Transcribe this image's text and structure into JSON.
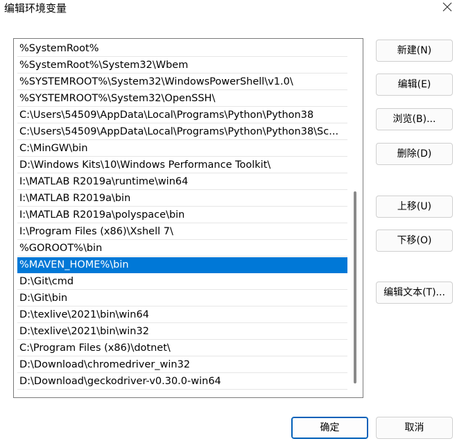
{
  "window": {
    "title": "编辑环境变量"
  },
  "path_list": {
    "items": [
      "%SystemRoot%",
      "%SystemRoot%\\System32\\Wbem",
      "%SYSTEMROOT%\\System32\\WindowsPowerShell\\v1.0\\",
      "%SYSTEMROOT%\\System32\\OpenSSH\\",
      "C:\\Users\\54509\\AppData\\Local\\Programs\\Python\\Python38",
      "C:\\Users\\54509\\AppData\\Local\\Programs\\Python\\Python38\\Sc...",
      "C:\\MinGW\\bin",
      "D:\\Windows Kits\\10\\Windows Performance Toolkit\\",
      "I:\\MATLAB R2019a\\runtime\\win64",
      "I:\\MATLAB R2019a\\bin",
      "I:\\MATLAB R2019a\\polyspace\\bin",
      "I:\\Program Files (x86)\\Xshell 7\\",
      "%GOROOT%\\bin",
      "%MAVEN_HOME%\\bin",
      "D:\\Git\\cmd",
      "D:\\Git\\bin",
      "D:\\texlive\\2021\\bin\\win64",
      "D:\\texlive\\2021\\bin\\win32",
      "C:\\Program Files (x86)\\dotnet\\",
      "D:\\Download\\chromedriver_win32",
      "D:\\Download\\geckodriver-v0.30.0-win64"
    ],
    "selected_index": 13
  },
  "buttons": {
    "new": "新建(N)",
    "edit": "编辑(E)",
    "browse": "浏览(B)...",
    "delete": "删除(D)",
    "move_up": "上移(U)",
    "move_down": "下移(O)",
    "edit_text": "编辑文本(T)...",
    "ok": "确定",
    "cancel": "取消"
  },
  "colors": {
    "selection": "#0078d7",
    "primary_border": "#005fb8"
  }
}
